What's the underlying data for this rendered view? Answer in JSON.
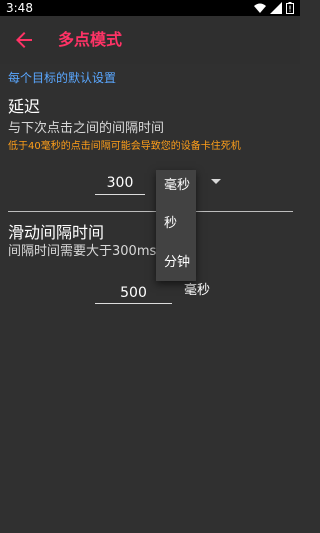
{
  "status_bar": {
    "time": "3:48",
    "icons": [
      "wifi-icon",
      "signal-icon",
      "battery-alert-icon"
    ]
  },
  "app_bar": {
    "back_icon": "back-arrow-icon",
    "title": "多点模式"
  },
  "settings": {
    "section_header": "每个目标的默认设置",
    "delay": {
      "title": "延迟",
      "description": "与下次点击之间的间隔时间",
      "warning": "低于40毫秒的点击间隔可能会导致您的设备卡住死机",
      "value": "300",
      "unit_selected": "毫秒"
    },
    "slide": {
      "title": "滑动间隔时间",
      "description": "间隔时间需要大于300ms",
      "value": "500",
      "unit": "毫秒"
    }
  },
  "dropdown": {
    "options": [
      "毫秒",
      "秒",
      "分钟"
    ]
  },
  "colors": {
    "accent": "#ff3366",
    "link": "#5aa7ff",
    "warning": "#ff9f1a",
    "background": "#303030"
  }
}
